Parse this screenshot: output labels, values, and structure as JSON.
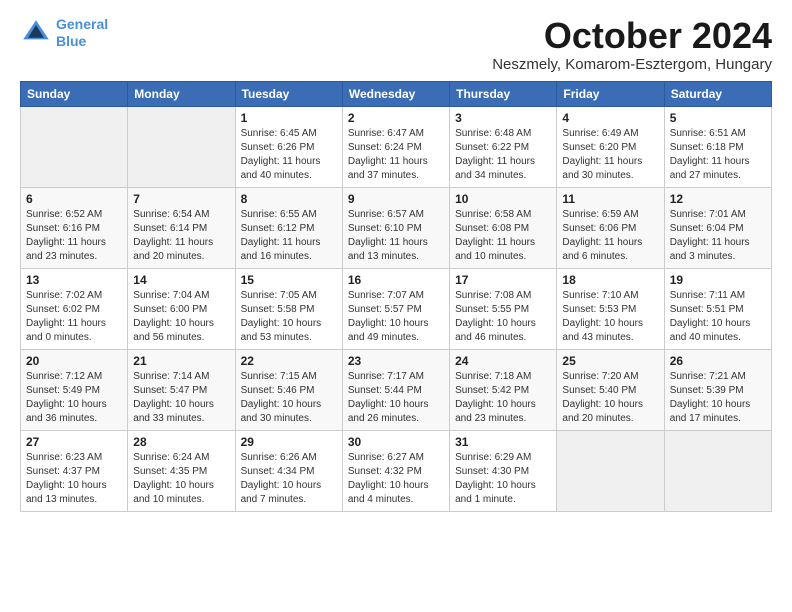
{
  "logo": {
    "line1": "General",
    "line2": "Blue"
  },
  "title": "October 2024",
  "location": "Neszmely, Komarom-Esztergom, Hungary",
  "weekdays": [
    "Sunday",
    "Monday",
    "Tuesday",
    "Wednesday",
    "Thursday",
    "Friday",
    "Saturday"
  ],
  "weeks": [
    [
      {
        "day": null
      },
      {
        "day": null
      },
      {
        "day": "1",
        "sunrise": "Sunrise: 6:45 AM",
        "sunset": "Sunset: 6:26 PM",
        "daylight": "Daylight: 11 hours and 40 minutes."
      },
      {
        "day": "2",
        "sunrise": "Sunrise: 6:47 AM",
        "sunset": "Sunset: 6:24 PM",
        "daylight": "Daylight: 11 hours and 37 minutes."
      },
      {
        "day": "3",
        "sunrise": "Sunrise: 6:48 AM",
        "sunset": "Sunset: 6:22 PM",
        "daylight": "Daylight: 11 hours and 34 minutes."
      },
      {
        "day": "4",
        "sunrise": "Sunrise: 6:49 AM",
        "sunset": "Sunset: 6:20 PM",
        "daylight": "Daylight: 11 hours and 30 minutes."
      },
      {
        "day": "5",
        "sunrise": "Sunrise: 6:51 AM",
        "sunset": "Sunset: 6:18 PM",
        "daylight": "Daylight: 11 hours and 27 minutes."
      }
    ],
    [
      {
        "day": "6",
        "sunrise": "Sunrise: 6:52 AM",
        "sunset": "Sunset: 6:16 PM",
        "daylight": "Daylight: 11 hours and 23 minutes."
      },
      {
        "day": "7",
        "sunrise": "Sunrise: 6:54 AM",
        "sunset": "Sunset: 6:14 PM",
        "daylight": "Daylight: 11 hours and 20 minutes."
      },
      {
        "day": "8",
        "sunrise": "Sunrise: 6:55 AM",
        "sunset": "Sunset: 6:12 PM",
        "daylight": "Daylight: 11 hours and 16 minutes."
      },
      {
        "day": "9",
        "sunrise": "Sunrise: 6:57 AM",
        "sunset": "Sunset: 6:10 PM",
        "daylight": "Daylight: 11 hours and 13 minutes."
      },
      {
        "day": "10",
        "sunrise": "Sunrise: 6:58 AM",
        "sunset": "Sunset: 6:08 PM",
        "daylight": "Daylight: 11 hours and 10 minutes."
      },
      {
        "day": "11",
        "sunrise": "Sunrise: 6:59 AM",
        "sunset": "Sunset: 6:06 PM",
        "daylight": "Daylight: 11 hours and 6 minutes."
      },
      {
        "day": "12",
        "sunrise": "Sunrise: 7:01 AM",
        "sunset": "Sunset: 6:04 PM",
        "daylight": "Daylight: 11 hours and 3 minutes."
      }
    ],
    [
      {
        "day": "13",
        "sunrise": "Sunrise: 7:02 AM",
        "sunset": "Sunset: 6:02 PM",
        "daylight": "Daylight: 11 hours and 0 minutes."
      },
      {
        "day": "14",
        "sunrise": "Sunrise: 7:04 AM",
        "sunset": "Sunset: 6:00 PM",
        "daylight": "Daylight: 10 hours and 56 minutes."
      },
      {
        "day": "15",
        "sunrise": "Sunrise: 7:05 AM",
        "sunset": "Sunset: 5:58 PM",
        "daylight": "Daylight: 10 hours and 53 minutes."
      },
      {
        "day": "16",
        "sunrise": "Sunrise: 7:07 AM",
        "sunset": "Sunset: 5:57 PM",
        "daylight": "Daylight: 10 hours and 49 minutes."
      },
      {
        "day": "17",
        "sunrise": "Sunrise: 7:08 AM",
        "sunset": "Sunset: 5:55 PM",
        "daylight": "Daylight: 10 hours and 46 minutes."
      },
      {
        "day": "18",
        "sunrise": "Sunrise: 7:10 AM",
        "sunset": "Sunset: 5:53 PM",
        "daylight": "Daylight: 10 hours and 43 minutes."
      },
      {
        "day": "19",
        "sunrise": "Sunrise: 7:11 AM",
        "sunset": "Sunset: 5:51 PM",
        "daylight": "Daylight: 10 hours and 40 minutes."
      }
    ],
    [
      {
        "day": "20",
        "sunrise": "Sunrise: 7:12 AM",
        "sunset": "Sunset: 5:49 PM",
        "daylight": "Daylight: 10 hours and 36 minutes."
      },
      {
        "day": "21",
        "sunrise": "Sunrise: 7:14 AM",
        "sunset": "Sunset: 5:47 PM",
        "daylight": "Daylight: 10 hours and 33 minutes."
      },
      {
        "day": "22",
        "sunrise": "Sunrise: 7:15 AM",
        "sunset": "Sunset: 5:46 PM",
        "daylight": "Daylight: 10 hours and 30 minutes."
      },
      {
        "day": "23",
        "sunrise": "Sunrise: 7:17 AM",
        "sunset": "Sunset: 5:44 PM",
        "daylight": "Daylight: 10 hours and 26 minutes."
      },
      {
        "day": "24",
        "sunrise": "Sunrise: 7:18 AM",
        "sunset": "Sunset: 5:42 PM",
        "daylight": "Daylight: 10 hours and 23 minutes."
      },
      {
        "day": "25",
        "sunrise": "Sunrise: 7:20 AM",
        "sunset": "Sunset: 5:40 PM",
        "daylight": "Daylight: 10 hours and 20 minutes."
      },
      {
        "day": "26",
        "sunrise": "Sunrise: 7:21 AM",
        "sunset": "Sunset: 5:39 PM",
        "daylight": "Daylight: 10 hours and 17 minutes."
      }
    ],
    [
      {
        "day": "27",
        "sunrise": "Sunrise: 6:23 AM",
        "sunset": "Sunset: 4:37 PM",
        "daylight": "Daylight: 10 hours and 13 minutes."
      },
      {
        "day": "28",
        "sunrise": "Sunrise: 6:24 AM",
        "sunset": "Sunset: 4:35 PM",
        "daylight": "Daylight: 10 hours and 10 minutes."
      },
      {
        "day": "29",
        "sunrise": "Sunrise: 6:26 AM",
        "sunset": "Sunset: 4:34 PM",
        "daylight": "Daylight: 10 hours and 7 minutes."
      },
      {
        "day": "30",
        "sunrise": "Sunrise: 6:27 AM",
        "sunset": "Sunset: 4:32 PM",
        "daylight": "Daylight: 10 hours and 4 minutes."
      },
      {
        "day": "31",
        "sunrise": "Sunrise: 6:29 AM",
        "sunset": "Sunset: 4:30 PM",
        "daylight": "Daylight: 10 hours and 1 minute."
      },
      {
        "day": null
      },
      {
        "day": null
      }
    ]
  ]
}
